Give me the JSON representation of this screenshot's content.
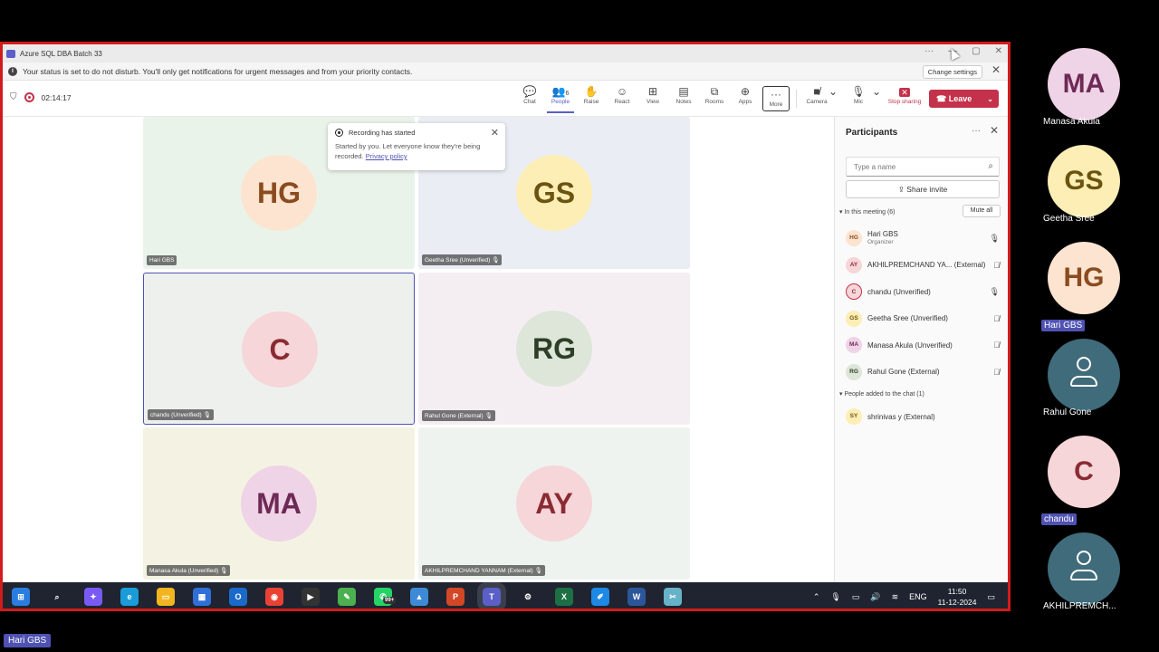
{
  "window": {
    "title": "Azure SQL DBA Batch 33",
    "controls": [
      "···",
      "—",
      "▢",
      "✕"
    ]
  },
  "banner": {
    "text": "Your status is set to do not disturb. You'll only get notifications for urgent messages and from your priority contacts.",
    "button": "Change settings"
  },
  "toolbar": {
    "timer": "02:14:17",
    "items": [
      {
        "label": "Chat",
        "icon": "chat-icon"
      },
      {
        "label": "People",
        "icon": "people-icon",
        "count": "6"
      },
      {
        "label": "Raise",
        "icon": "raise-hand-icon"
      },
      {
        "label": "React",
        "icon": "react-icon"
      },
      {
        "label": "View",
        "icon": "view-icon"
      },
      {
        "label": "Notes",
        "icon": "notes-icon"
      },
      {
        "label": "Rooms",
        "icon": "rooms-icon"
      },
      {
        "label": "Apps",
        "icon": "apps-icon"
      },
      {
        "label": "More",
        "icon": "more-icon"
      }
    ],
    "camera": "Camera",
    "mic": "Mic",
    "stop_sharing": "Stop sharing",
    "leave": "Leave"
  },
  "toast": {
    "title": "Recording has started",
    "body": "Started by you. Let everyone know they're being recorded.",
    "link": "Privacy policy"
  },
  "tiles": [
    {
      "initials": "HG",
      "name": "Hari GBS",
      "bg": "#eaf3ea",
      "avbg": "#fce4d0",
      "avfg": "#8a4b1e"
    },
    {
      "initials": "GS",
      "name": "Geetha Sree (Unverified)",
      "bg": "#ebedf5",
      "avbg": "#fdeeb5",
      "avfg": "#6b5310"
    },
    {
      "initials": "C",
      "name": "chandu (Unverified)",
      "bg": "#eef0ee",
      "avbg": "#f6d6d8",
      "avfg": "#8a2b33"
    },
    {
      "initials": "RG",
      "name": "Rahul Gone (External)",
      "bg": "#f4eef3",
      "avbg": "#dde6d9",
      "avfg": "#2d3f26"
    },
    {
      "initials": "MA",
      "name": "Manasa Akula (Unverified)",
      "bg": "#f4f3e3",
      "avbg": "#efd3e6",
      "avfg": "#6d2a56"
    },
    {
      "initials": "AY",
      "name": "AKHILPREMCHAND YANNAM (External)",
      "bg": "#eef3ef",
      "avbg": "#f6d6d8",
      "avfg": "#8a2b33"
    }
  ],
  "participants": {
    "title": "Participants",
    "search_placeholder": "Type a name",
    "share_invite": "Share invite",
    "in_meeting_label": "In this meeting (6)",
    "mute_all": "Mute all",
    "added_label": "People added to the chat (1)",
    "list": [
      {
        "initials": "HG",
        "name": "Hari GBS",
        "role": "Organizer",
        "bg": "#fce4d0",
        "fg": "#8a4b1e",
        "mic": "on"
      },
      {
        "initials": "AY",
        "name": "AKHILPREMCHAND YA... (External)",
        "role": "",
        "bg": "#f6d6d8",
        "fg": "#8a2b33",
        "mic": "muted"
      },
      {
        "initials": "C",
        "name": "chandu (Unverified)",
        "role": "",
        "bg": "#f6d6d8",
        "fg": "#8a2b33",
        "mic": "on"
      },
      {
        "initials": "GS",
        "name": "Geetha Sree (Unverified)",
        "role": "",
        "bg": "#fdeeb5",
        "fg": "#6b5310",
        "mic": "muted"
      },
      {
        "initials": "MA",
        "name": "Manasa Akula (Unverified)",
        "role": "",
        "bg": "#efd3e6",
        "fg": "#6d2a56",
        "mic": "muted"
      },
      {
        "initials": "RG",
        "name": "Rahul Gone (External)",
        "role": "",
        "bg": "#dde6d9",
        "fg": "#2d3f26",
        "mic": "muted"
      }
    ],
    "added": [
      {
        "initials": "SY",
        "name": "shrinivas y (External)",
        "bg": "#fdeeb5",
        "fg": "#6b5310"
      }
    ]
  },
  "taskbar": {
    "apps": [
      "windows",
      "search",
      "copilot",
      "edge",
      "explorer",
      "store",
      "outlook",
      "chrome",
      "terminal",
      "notepad",
      "whatsapp",
      "photos",
      "powerpoint",
      "teams",
      "settings",
      "excel",
      "paint",
      "word",
      "snip"
    ],
    "whatsapp_badge": "99+",
    "language": "ENG",
    "time": "11:50",
    "date": "11-12-2024"
  },
  "gallery": [
    {
      "initials": "MA",
      "label": "Manasa Akula",
      "bg": "#efd3e6",
      "fg": "#6d2a56",
      "badge": false
    },
    {
      "initials": "GS",
      "label": "Geetha Sree",
      "bg": "#fdeeb5",
      "fg": "#6b5310",
      "badge": false
    },
    {
      "initials": "HG",
      "label": "Hari GBS",
      "bg": "#fce4d0",
      "fg": "#8a4b1e",
      "badge": true
    },
    {
      "initials": "",
      "label": "Rahul Gone",
      "bg": "#3f6b7a",
      "fg": "#fff",
      "badge": false
    },
    {
      "initials": "C",
      "label": "chandu",
      "bg": "#f6d6d8",
      "fg": "#8a2b33",
      "badge": true
    },
    {
      "initials": "",
      "label": "AKHILPREMCH...",
      "bg": "#3f6b7a",
      "fg": "#fff",
      "badge": false
    }
  ],
  "self_view_label": "Hari GBS",
  "colors": {
    "accent": "#4f52b2",
    "leave": "#c4314b",
    "frame": "#d21b1b"
  }
}
